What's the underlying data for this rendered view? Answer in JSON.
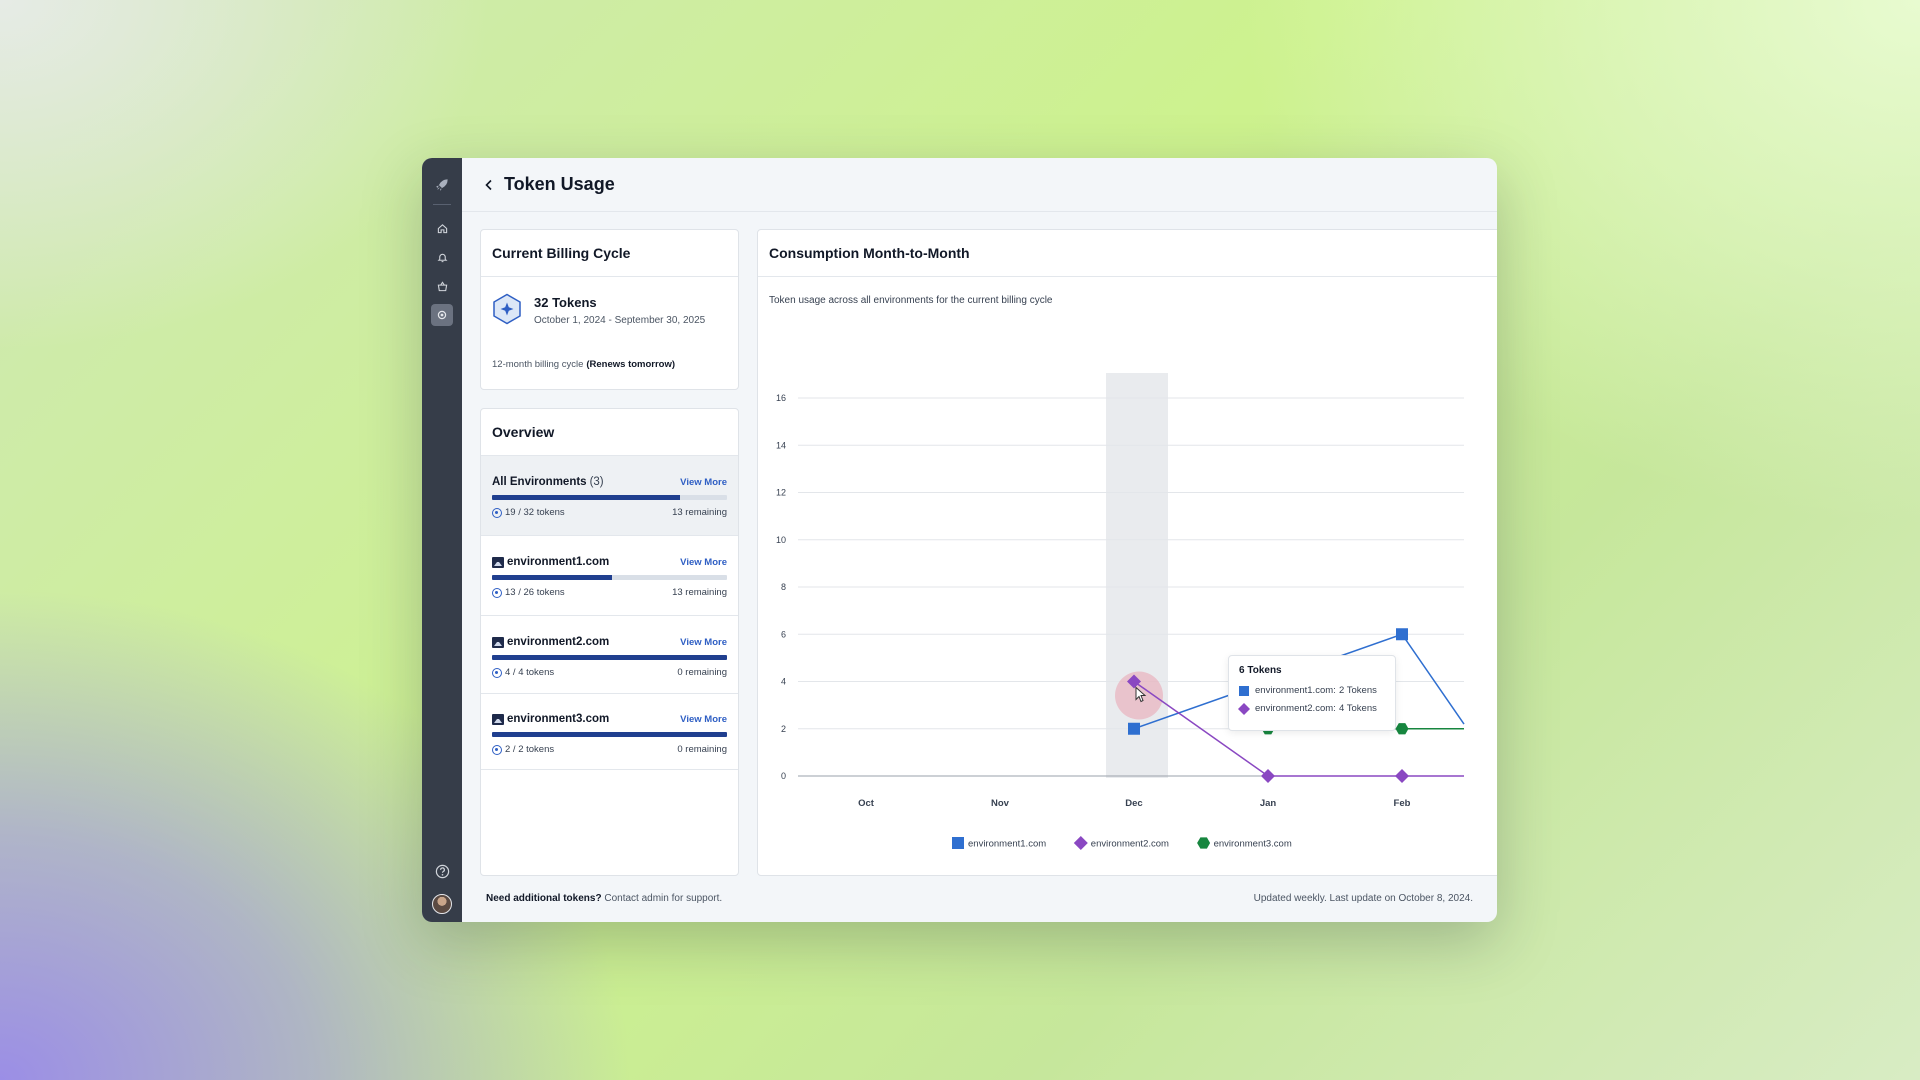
{
  "page": {
    "title": "Token Usage"
  },
  "billing": {
    "title": "Current Billing Cycle",
    "amount": "32 Tokens",
    "dates": "October 1, 2024 - September 30, 2025",
    "cycle_label": "12-month billing cycle",
    "renews": "(Renews tomorrow)"
  },
  "overview": {
    "title": "Overview",
    "view_more": "View More",
    "rows": [
      {
        "name": "All Environments",
        "count": "(3)",
        "usage": "19 / 32 tokens",
        "remaining": "13 remaining",
        "fill": 0.8
      },
      {
        "name": "environment1.com",
        "usage": "13 / 26 tokens",
        "remaining": "13 remaining",
        "fill": 0.51
      },
      {
        "name": "environment2.com",
        "usage": "4 / 4 tokens",
        "remaining": "0 remaining",
        "fill": 1.0
      },
      {
        "name": "environment3.com",
        "usage": "2 / 2 tokens",
        "remaining": "0 remaining",
        "fill": 1.0
      }
    ]
  },
  "chart": {
    "title": "Consumption Month-to-Month",
    "subtitle": "Token usage across all environments for the current billing cycle"
  },
  "chart_data": {
    "type": "line",
    "categories": [
      "Oct",
      "Nov",
      "Dec",
      "Jan",
      "Feb"
    ],
    "ylim": [
      0,
      16
    ],
    "yticks": [
      "0",
      "2",
      "4",
      "6",
      "8",
      "10",
      "12",
      "14",
      "16"
    ],
    "grid": true,
    "legend": "bottom",
    "highlight_category": "Dec",
    "series": [
      {
        "name": "environment1.com",
        "values": [
          null,
          null,
          2,
          4,
          6
        ],
        "tail": 2.2,
        "color": "#2f6fd0",
        "marker": "square"
      },
      {
        "name": "environment2.com",
        "values": [
          null,
          null,
          4,
          0,
          0
        ],
        "tail": 0,
        "color": "#8a48c2",
        "marker": "diamond"
      },
      {
        "name": "environment3.com",
        "values": [
          null,
          null,
          null,
          2,
          2
        ],
        "tail": 2,
        "color": "#17863f",
        "marker": "hexagon"
      }
    ]
  },
  "tooltip": {
    "title": "6 Tokens",
    "rows": [
      {
        "label": "environment1.com:",
        "value": "2 Tokens",
        "color": "#2f6fd0"
      },
      {
        "label": "environment2.com:",
        "value": "4 Tokens",
        "color": "#8a48c2"
      }
    ]
  },
  "footer": {
    "need": "Need additional tokens?",
    "contact": "Contact admin for support.",
    "updated": "Updated weekly. Last update on October 8, 2024."
  },
  "icons": [
    "rocket-icon",
    "home-icon",
    "bell-icon",
    "basket-icon",
    "settings-icon",
    "help-icon",
    "back-chevron-icon"
  ]
}
